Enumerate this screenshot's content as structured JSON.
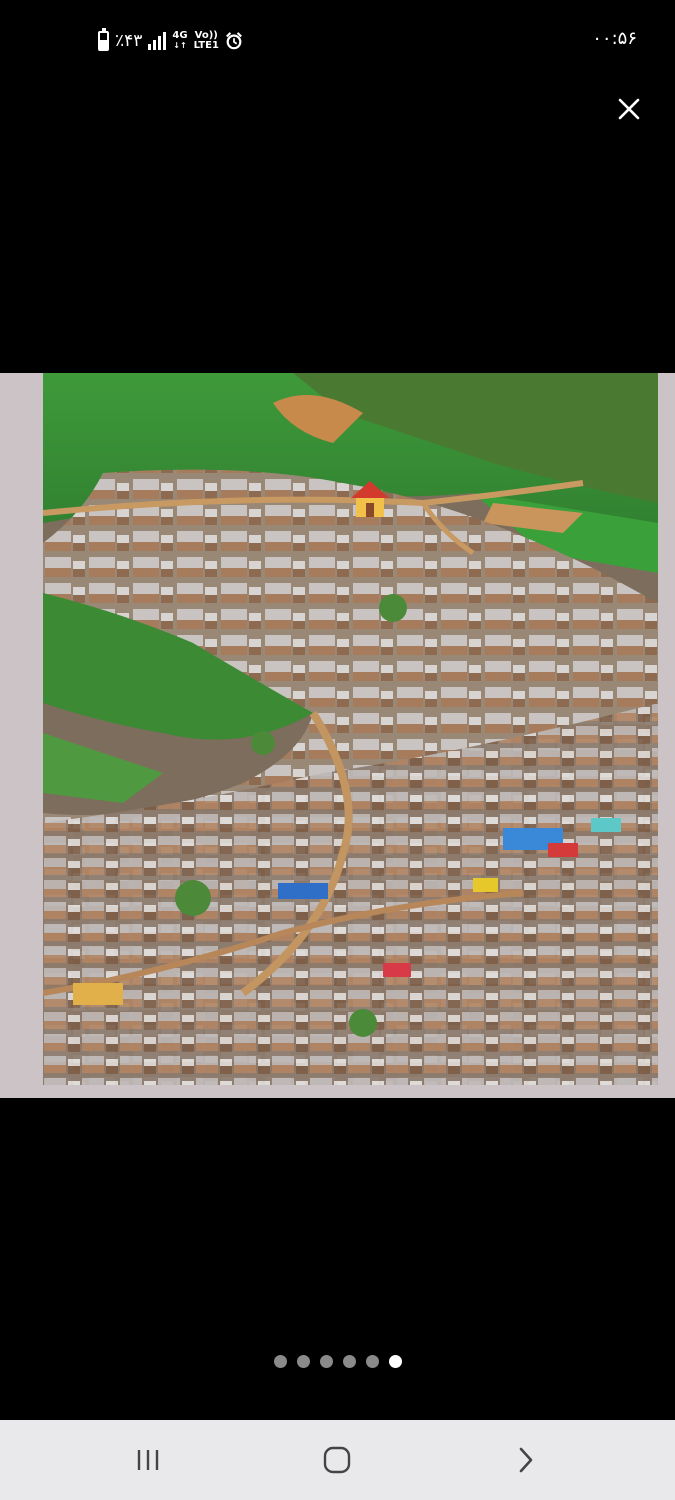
{
  "status_bar": {
    "battery": "٪۴۳",
    "network_top": "4G",
    "volte_top": "Vo))",
    "volte_bottom": "LTE1",
    "time": "۰۰:۵۶"
  },
  "viewer": {
    "close_icon": "close-icon",
    "image_description_icon": "landscape-photo",
    "page_count": 6,
    "active_page": 6
  },
  "nav_bar": {
    "recent_icon": "recent-apps-icon",
    "home_icon": "home-icon",
    "back_icon": "back-icon"
  },
  "colors": {
    "background": "#000000",
    "nav_bar": "#e9e9eb",
    "dot_active": "#ffffff",
    "dot_inactive": "#8a8a8a"
  }
}
